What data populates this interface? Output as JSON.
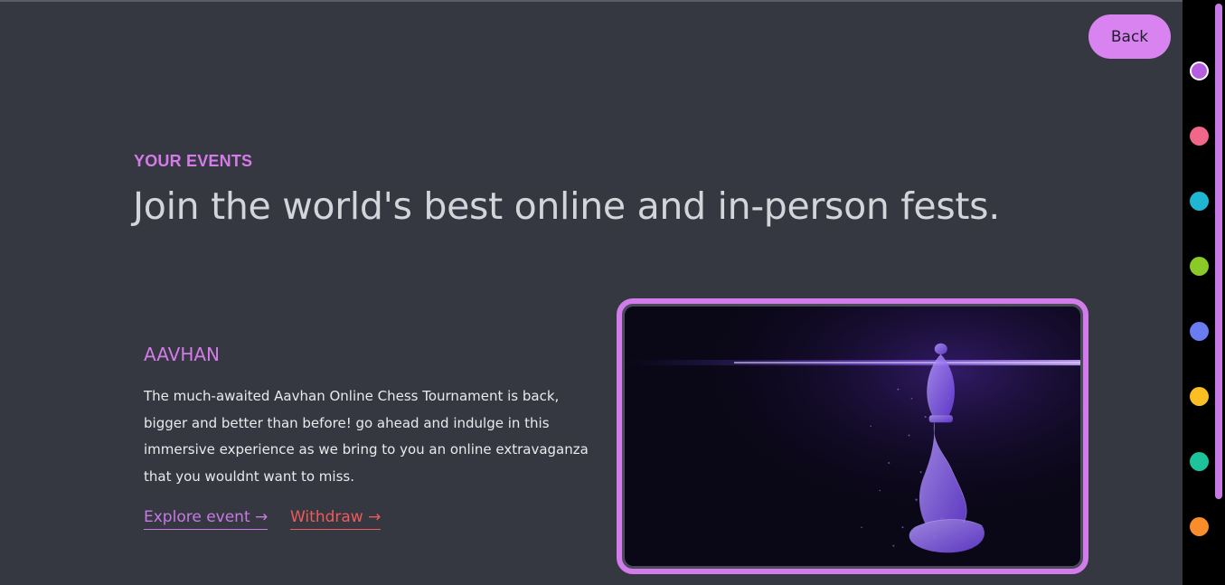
{
  "header": {
    "back_label": "Back"
  },
  "hero": {
    "eyebrow": "YOUR EVENTS",
    "headline": "Join the world's best online and in-person fests."
  },
  "event": {
    "title": "AAVHAN",
    "description": "The much-awaited Aavhan Online Chess Tournament is back, bigger and better than before! go ahead and indulge in this immersive experience as we bring to you an online extravaganza that you wouldnt want to miss.",
    "explore_label": "Explore event →",
    "withdraw_label": "Withdraw →",
    "image_alt": "glowing purple chess bishop"
  },
  "theme_swatches": [
    {
      "name": "purple",
      "color": "#b65ee0",
      "active": true
    },
    {
      "name": "pink",
      "color": "#f0678a",
      "active": false
    },
    {
      "name": "cyan",
      "color": "#1fb6d2",
      "active": false
    },
    {
      "name": "lime",
      "color": "#8ac926",
      "active": false
    },
    {
      "name": "blue",
      "color": "#6a7cf2",
      "active": false
    },
    {
      "name": "yellow",
      "color": "#fbbf24",
      "active": false
    },
    {
      "name": "green",
      "color": "#1dc39a",
      "active": false
    },
    {
      "name": "orange",
      "color": "#fb8c2c",
      "active": false
    }
  ],
  "colors": {
    "accent": "#d47be9",
    "background": "#353840",
    "withdraw": "#ef5a5a"
  }
}
